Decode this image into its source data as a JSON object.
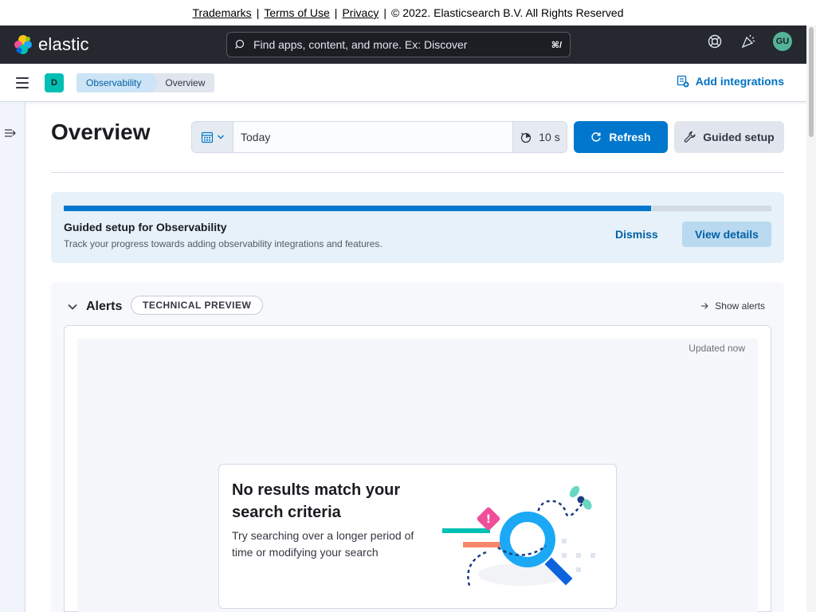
{
  "legal": {
    "trademarks": "Trademarks",
    "sep1": "|",
    "terms": "Terms of Use",
    "sep2": "|",
    "privacy": "Privacy",
    "sep3": "|",
    "copyright": "© 2022. Elasticsearch B.V. All Rights Reserved"
  },
  "header": {
    "brand": "elastic",
    "search_placeholder": "Find apps, content, and more. Ex: Discover",
    "search_shortcut": "⌘/",
    "avatar_initials": "GU",
    "icons": [
      "help-icon",
      "newsfeed-icon",
      "user-avatar"
    ]
  },
  "subheader": {
    "space_initial": "D",
    "breadcrumbs": [
      "Observability",
      "Overview"
    ],
    "add_integrations": "Add integrations"
  },
  "page": {
    "title": "Overview",
    "date_value": "Today",
    "refresh_interval": "10 s",
    "refresh_label": "Refresh",
    "guided_setup_label": "Guided setup"
  },
  "guided_panel": {
    "progress_fraction": 0.83,
    "title": "Guided setup for Observability",
    "description": "Track your progress towards adding observability integrations and features.",
    "dismiss": "Dismiss",
    "view_details": "View details"
  },
  "alerts": {
    "title": "Alerts",
    "badge": "TECHNICAL PREVIEW",
    "show_alerts": "Show alerts",
    "updated": "Updated now",
    "empty_title": "No results match your search criteria",
    "empty_body": "Try searching over a longer period of time or modifying your search"
  },
  "colors": {
    "header_bg": "#25282f",
    "primary": "#0077cc",
    "link": "#0061a6",
    "callout_bg": "#e6f1fa",
    "space_badge": "#00bfb3",
    "avatar": "#54b399"
  }
}
